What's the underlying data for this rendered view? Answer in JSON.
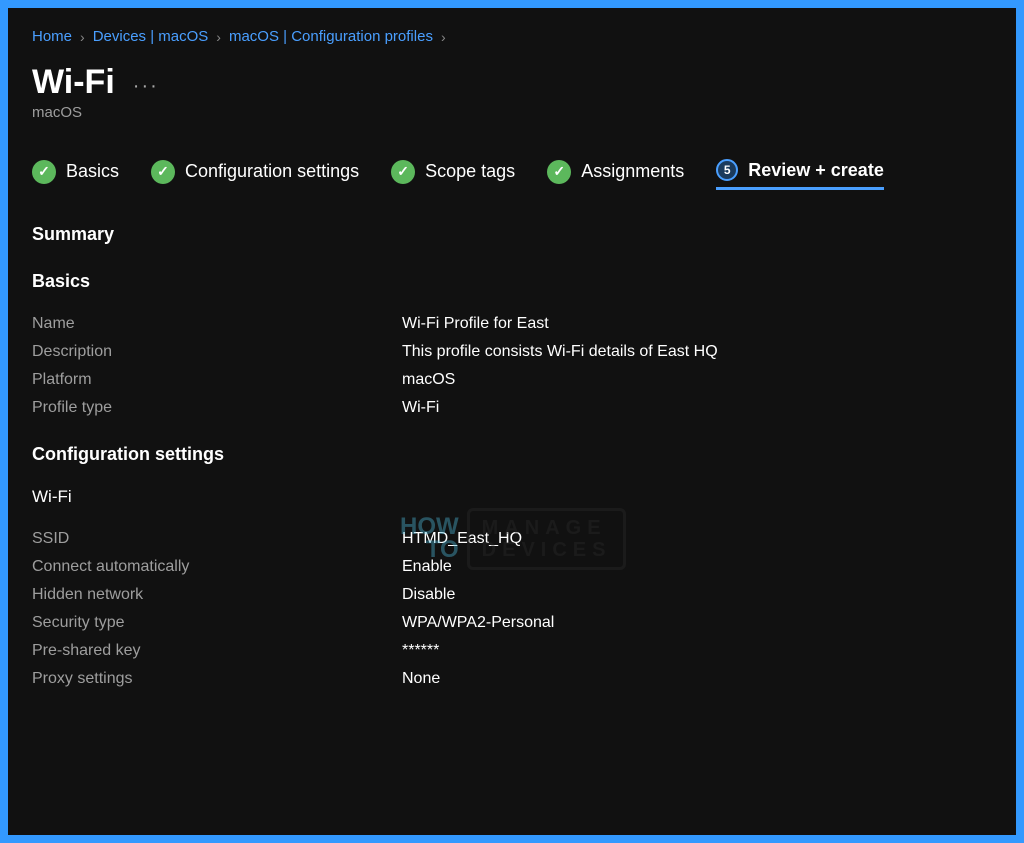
{
  "breadcrumb": {
    "items": [
      "Home",
      "Devices | macOS",
      "macOS | Configuration profiles"
    ]
  },
  "header": {
    "title": "Wi-Fi",
    "subtitle": "macOS"
  },
  "tabs": {
    "items": [
      {
        "label": "Basics",
        "state": "check"
      },
      {
        "label": "Configuration settings",
        "state": "check"
      },
      {
        "label": "Scope tags",
        "state": "check"
      },
      {
        "label": "Assignments",
        "state": "check"
      },
      {
        "label": "Review + create",
        "state": "number",
        "number": "5"
      }
    ]
  },
  "summary": {
    "heading": "Summary"
  },
  "basics": {
    "title": "Basics",
    "rows": {
      "name": {
        "label": "Name",
        "value": "Wi-Fi Profile for East"
      },
      "description": {
        "label": "Description",
        "value": "This profile consists Wi-Fi details of East HQ"
      },
      "platform": {
        "label": "Platform",
        "value": "macOS"
      },
      "profile_type": {
        "label": "Profile type",
        "value": "Wi-Fi"
      }
    }
  },
  "config": {
    "title": "Configuration settings",
    "wifi_title": "Wi-Fi",
    "rows": {
      "ssid": {
        "label": "SSID",
        "value": "HTMD_East_HQ"
      },
      "connect_auto": {
        "label": "Connect automatically",
        "value": "Enable"
      },
      "hidden": {
        "label": "Hidden network",
        "value": "Disable"
      },
      "security": {
        "label": "Security type",
        "value": "WPA/WPA2-Personal"
      },
      "psk": {
        "label": "Pre-shared key",
        "value": "******"
      },
      "proxy": {
        "label": "Proxy settings",
        "value": "None"
      }
    }
  },
  "watermark": {
    "how": "HOW",
    "to": "TO",
    "manage": "MANAGE",
    "devices": "DEVICES"
  }
}
